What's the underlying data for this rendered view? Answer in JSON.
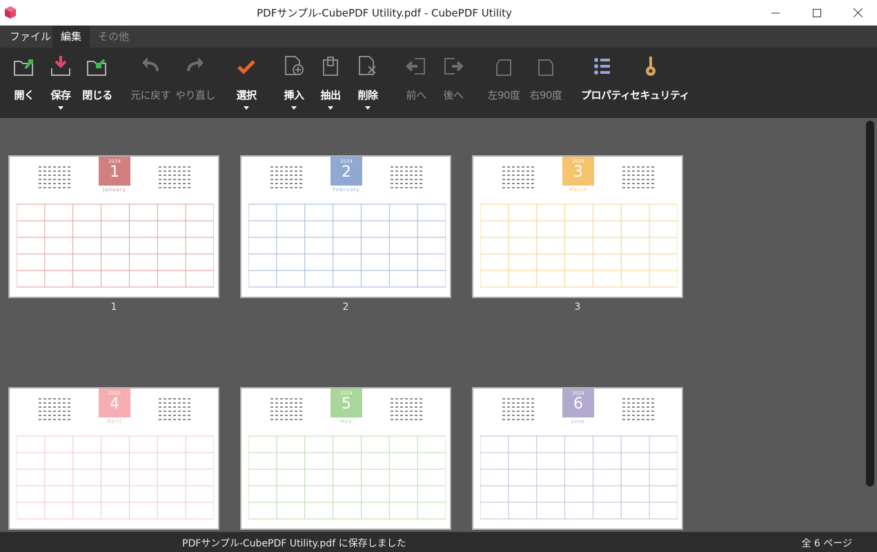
{
  "window": {
    "title": "PDFサンプル-CubePDF Utility.pdf - CubePDF Utility"
  },
  "menu": {
    "tabs": [
      "ファイル",
      "編集",
      "その他"
    ]
  },
  "toolbar": {
    "open": "開く",
    "save": "保存",
    "close": "閉じる",
    "undo": "元に戻す",
    "redo": "やり直し",
    "select": "選択",
    "insert": "挿入",
    "extract": "抽出",
    "delete": "削除",
    "prev": "前へ",
    "next": "後へ",
    "rotate_left": "左90度",
    "rotate_right": "右90度",
    "properties": "プロパティ",
    "security": "セキュリティ"
  },
  "pages": [
    {
      "label": "1",
      "year": "2024",
      "month": "1",
      "name": "January",
      "color": "#d27f7f",
      "line": "#e59a9a"
    },
    {
      "label": "2",
      "year": "2024",
      "month": "2",
      "name": "February",
      "color": "#8fa9d3",
      "line": "#9fb6dc"
    },
    {
      "label": "3",
      "year": "2024",
      "month": "3",
      "name": "March",
      "color": "#f7c46e",
      "line": "#f7cf87"
    },
    {
      "label": "4",
      "year": "2024",
      "month": "4",
      "name": "April",
      "color": "#f7aeb3",
      "line": "#f8c0c4"
    },
    {
      "label": "5",
      "year": "2024",
      "month": "5",
      "name": "May",
      "color": "#a9d69a",
      "line": "#b5dca8"
    },
    {
      "label": "6",
      "year": "2024",
      "month": "6",
      "name": "June",
      "color": "#b3aad0",
      "line": "#c2bbd9"
    }
  ],
  "status": {
    "message": "PDFサンプル-CubePDF Utility.pdf に保存しました",
    "page_count": "全 6 ページ"
  }
}
